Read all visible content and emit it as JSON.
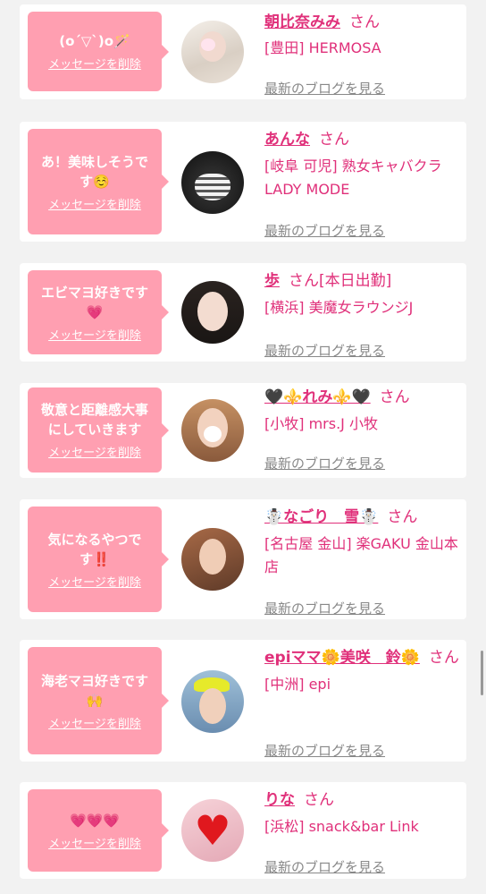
{
  "delete_label": "メッセージを削除",
  "blog_label": "最新のブログを見る",
  "san_label": "さん",
  "colors": {
    "accent": "#e0307a",
    "bubble": "#ff9fb1",
    "link_gray": "#888888",
    "background": "#f2f2f2"
  },
  "cards": [
    {
      "message": "(o´▽`)o🪄",
      "name": "朝比奈みみ",
      "san_suffix": "",
      "shop": "[豊田] HERMOSA"
    },
    {
      "message": "あ！美味しそうです☺️",
      "name": "あんな",
      "san_suffix": "",
      "shop": "[岐阜 可児] 熟女キャバクラ LADY MODE"
    },
    {
      "message": "エビマヨ好きです💗",
      "name": "歩",
      "san_suffix": "[本日出勤]",
      "shop": "[横浜] 美魔女ラウンジJ"
    },
    {
      "message": "敬意と距離感大事にしていきます",
      "name": "🖤⚜️れみ⚜️🖤",
      "san_suffix": "",
      "shop": "[小牧] mrs.J 小牧"
    },
    {
      "message": "気になるやつです‼️",
      "name": "☃️なごり　雪☃️",
      "san_suffix": "",
      "shop": "[名古屋 金山] 楽GAKU 金山本店"
    },
    {
      "message": "海老マヨ好きです🙌",
      "name": "epiママ🌼美咲　鈴🌼",
      "san_suffix": "",
      "shop": "[中洲] epi"
    },
    {
      "message": "💗💗💗",
      "name": "りな",
      "san_suffix": "",
      "shop": "[浜松] snack&bar Link"
    }
  ]
}
